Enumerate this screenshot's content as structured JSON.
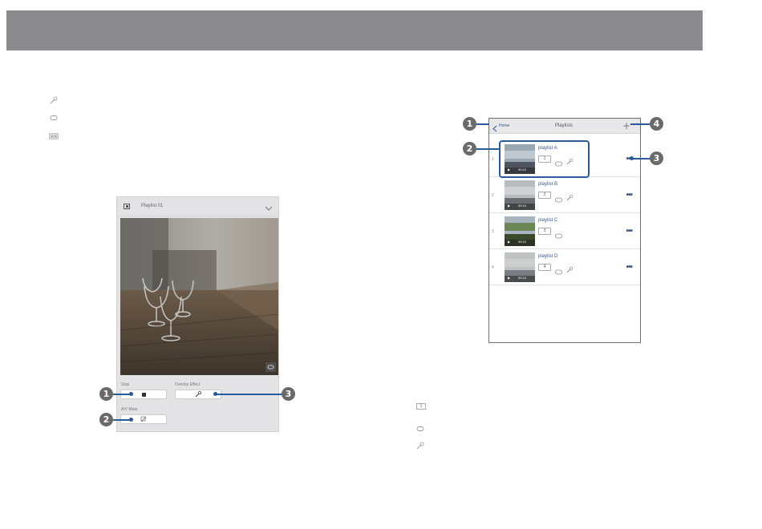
{
  "header": {},
  "legend_left": {
    "icons": [
      "overlay-effect-icon",
      "repeat-icon",
      "av-mute-icon"
    ]
  },
  "player": {
    "title": "Playlist 01",
    "stop_label": "Stop",
    "overlay_label": "Overlay Effect",
    "av_mute_label": "A/V Mute"
  },
  "callouts": {
    "one": "1",
    "two": "2",
    "three": "3",
    "four": "4"
  },
  "playlist_screen": {
    "home_label": "Home",
    "title": "Playlists",
    "items": [
      {
        "index": "1",
        "name": "playlist A",
        "count": "1",
        "duration": "00:10",
        "overlay": true,
        "thumb": "sky"
      },
      {
        "index": "2",
        "name": "playlist B",
        "count": "2",
        "duration": "00:10",
        "overlay": true,
        "thumb": "clouds"
      },
      {
        "index": "3",
        "name": "playlist C",
        "count": "3",
        "duration": "00:10",
        "overlay": false,
        "thumb": "field"
      },
      {
        "index": "4",
        "name": "playlist D",
        "count": "4",
        "duration": "00:10",
        "overlay": true,
        "thumb": "fog"
      }
    ]
  },
  "legend_right": {
    "count_sample": "1",
    "icons": [
      "count-badge-icon",
      "repeat-icon",
      "overlay-effect-icon"
    ]
  },
  "colors": {
    "header_bar": "#8a8a8f",
    "accent_blue": "#2a5aa0",
    "callout_gray": "#6a6a6a"
  }
}
